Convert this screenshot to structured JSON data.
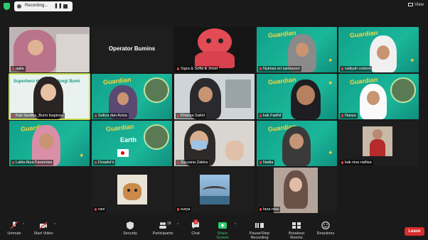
{
  "topbar": {
    "recording_label": "Recording...",
    "pause_icon": "pause-icon",
    "stop_icon": "stop-icon",
    "view_label": "View"
  },
  "participants": [
    {
      "name": "aqila",
      "type": "video"
    },
    {
      "name": "Operator Bumins",
      "type": "name-only"
    },
    {
      "name": "Sigra & Sofia & Joost",
      "type": "video"
    },
    {
      "name": "Nyimas eri saribanon",
      "type": "video"
    },
    {
      "name": "radiyah crebon",
      "type": "video"
    },
    {
      "name": "Kak Santika_Bumi Inspirasi",
      "type": "video",
      "speaking": true
    },
    {
      "name": "Safiya dan Aziza",
      "type": "video"
    },
    {
      "name": "Khansa Sakhi",
      "type": "video"
    },
    {
      "name": "kak Fadhil",
      "type": "video"
    },
    {
      "name": "Nasya",
      "type": "video"
    },
    {
      "name": "Lalita Atya Farannisa",
      "type": "video"
    },
    {
      "name": "Dzaakir's",
      "type": "video"
    },
    {
      "name": "Zayyana Zakira",
      "type": "video"
    },
    {
      "name": "Nadia",
      "type": "video"
    },
    {
      "name": "kak nisa nafiisa",
      "type": "photo"
    },
    {
      "name": "rani",
      "type": "photo"
    },
    {
      "name": "surya",
      "type": "photo"
    },
    {
      "name": "faza nisa",
      "type": "photo"
    }
  ],
  "slide_text": {
    "title_top": "Guardian",
    "title_bottom": "Earth",
    "small": "of the",
    "speaker_text": "Superhero Hari Melindungi Bumi"
  },
  "toolbar": {
    "unmute": "Unmute",
    "start_video": "Start Video",
    "security": "Security",
    "participants": "Participants",
    "participants_count": "18",
    "chat": "Chat",
    "chat_badge": "3",
    "share_screen": "Share Screen",
    "pause_stop_recording": "Pause/Stop Recording",
    "breakout_rooms": "Breakout Rooms",
    "reactions": "Reactions",
    "leave": "Leave"
  },
  "colors": {
    "speaking_border": "#c5e04a",
    "share_green": "#2ecc71",
    "leave_red": "#d92c2c",
    "slide_teal": "#1bb79a"
  }
}
